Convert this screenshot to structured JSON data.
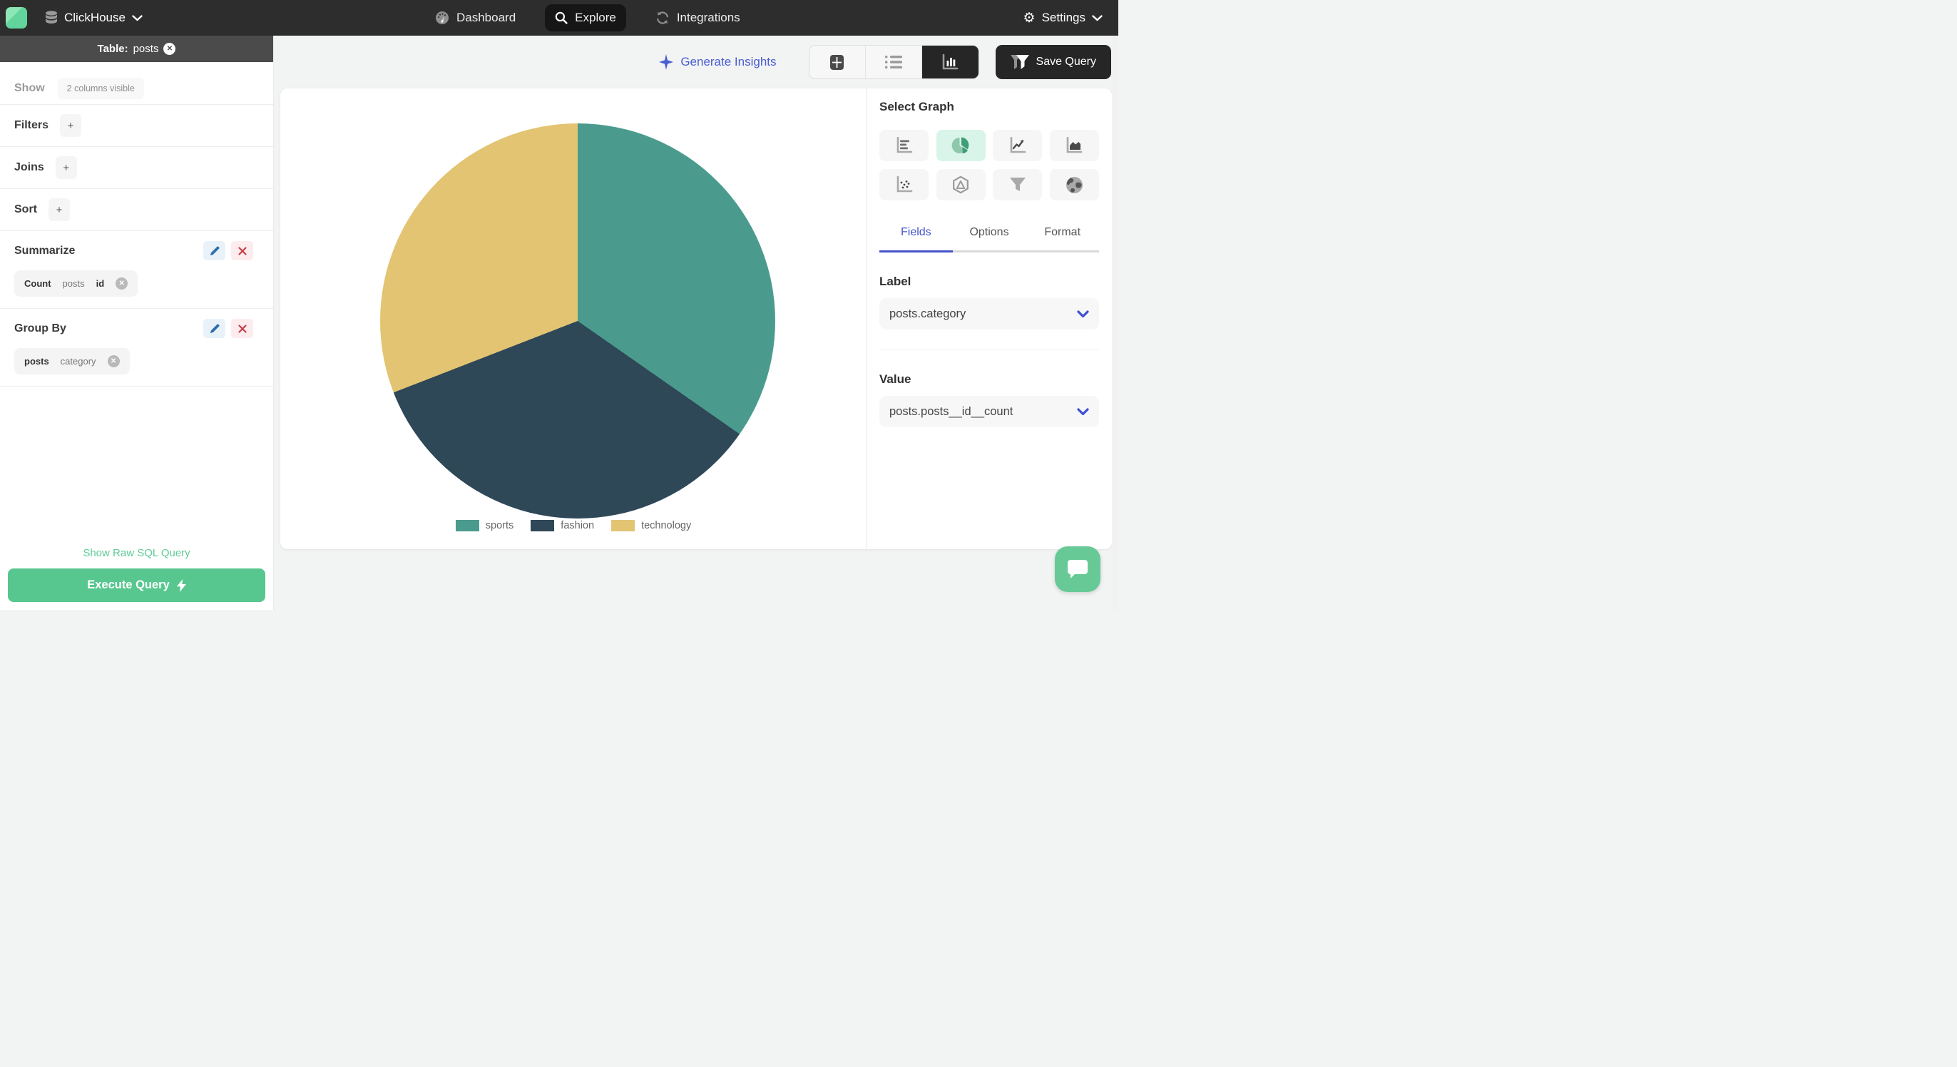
{
  "topnav": {
    "brand_label": "ClickHouse",
    "items": [
      {
        "label": "Dashboard",
        "icon": "gauge-icon",
        "active": false
      },
      {
        "label": "Explore",
        "icon": "search-icon",
        "active": true
      },
      {
        "label": "Integrations",
        "icon": "sync-icon",
        "active": false
      }
    ],
    "settings_label": "Settings"
  },
  "sidebar": {
    "table_header": {
      "prefix": "Table:",
      "name": "posts"
    },
    "show": {
      "label": "Show",
      "chip": "2 columns visible"
    },
    "filters": {
      "label": "Filters",
      "add": "+"
    },
    "joins": {
      "label": "Joins",
      "add": "+"
    },
    "sort": {
      "label": "Sort",
      "add": "+"
    },
    "summarize": {
      "label": "Summarize",
      "chip": [
        "Count",
        "posts",
        "id"
      ]
    },
    "group_by": {
      "label": "Group By",
      "chip": [
        "posts",
        "category"
      ]
    },
    "raw_sql_link": "Show Raw SQL Query",
    "execute_button": "Execute Query"
  },
  "toolbar": {
    "generate_insights": "Generate Insights",
    "save_query": "Save Query",
    "view_modes": [
      "table",
      "list",
      "chart"
    ],
    "active_view": "chart"
  },
  "graph_panel": {
    "title": "Select Graph",
    "types": [
      "bar",
      "pie",
      "line",
      "area",
      "scatter",
      "radar",
      "funnel",
      "map"
    ],
    "selected_type": "pie",
    "tabs": [
      "Fields",
      "Options",
      "Format"
    ],
    "active_tab": "Fields",
    "label_field": {
      "heading": "Label",
      "value": "posts.category"
    },
    "value_field": {
      "heading": "Value",
      "value": "posts.posts__id__count"
    }
  },
  "chart_data": {
    "type": "pie",
    "labels": [
      "sports",
      "fashion",
      "technology"
    ],
    "values_pct": [
      34.7,
      34.4,
      30.9
    ],
    "colors": [
      "#4a9b8e",
      "#2f4858",
      "#e2c472"
    ],
    "start_angle_deg": 0,
    "legend_position": "bottom",
    "title": ""
  },
  "theme": {
    "accent_green": "#57c78f",
    "accent_indigo": "#4a5ed1",
    "nav_bg": "#2d2d2d",
    "selected_tile_bg": "#d9f4e8"
  }
}
